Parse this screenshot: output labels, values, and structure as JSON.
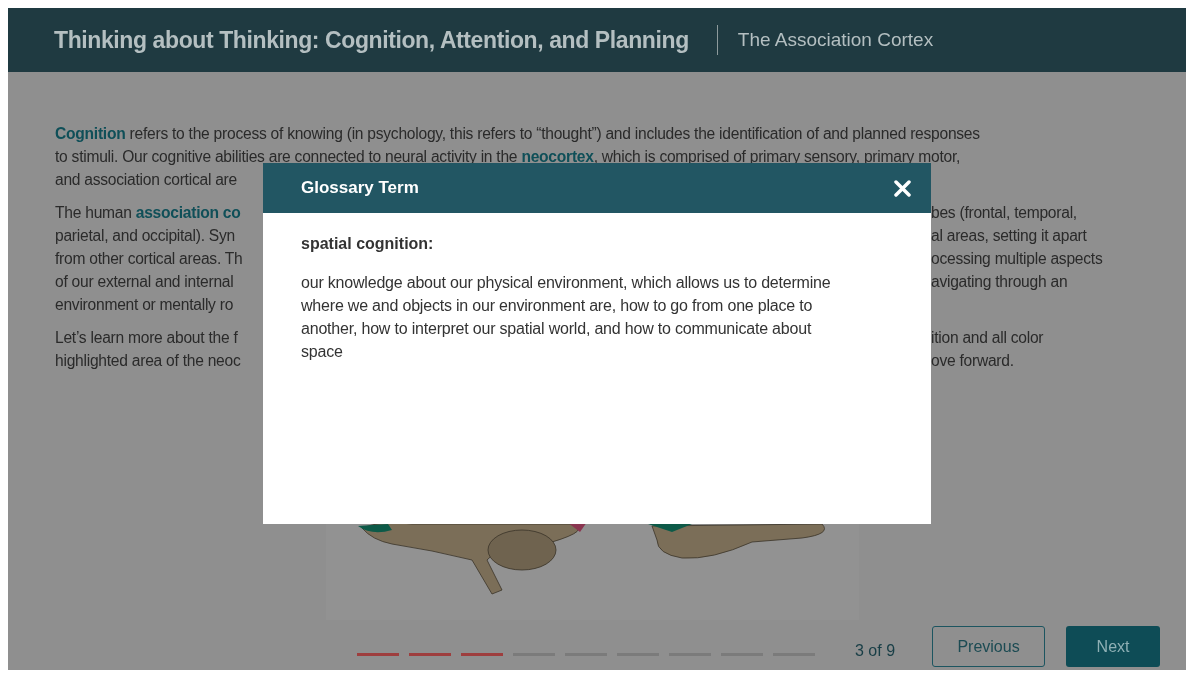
{
  "header": {
    "title": "Thinking about Thinking: Cognition, Attention, and Planning",
    "subtitle": "The Association Cortex"
  },
  "paragraphs": [
    {
      "lines": [
        {
          "left": "**Cognition** refers to the process of knowing (in psychology, this refers to “thought”) and includes the identification of and planned responses"
        },
        {
          "left": "to stimuli. Our cognitive abilities are connected to neural activity in the **neocortex**, which is comprised of primary sensory, primary motor,"
        },
        {
          "left": "and association cortical are"
        }
      ]
    },
    {
      "lines": [
        {
          "left": "The human **association co**",
          "right": "bes (frontal, temporal,"
        },
        {
          "left": "parietal, and occipital). Syn",
          "right": "al areas, setting it apart"
        },
        {
          "left": "from other cortical areas. Th",
          "right": "ocessing multiple aspects"
        },
        {
          "left": "of our external and internal",
          "right": "avigating through an"
        },
        {
          "left": "environment or mentally ro"
        }
      ]
    },
    {
      "lines": [
        {
          "left": "Let’s learn more about the f",
          "right": "ition and all color"
        },
        {
          "left": "highlighted area of the neoc",
          "right": "ove forward."
        }
      ]
    }
  ],
  "progress": {
    "steps": [
      {
        "completed": true
      },
      {
        "completed": true
      },
      {
        "completed": true
      },
      {
        "completed": false
      },
      {
        "completed": false
      },
      {
        "completed": false
      },
      {
        "completed": false
      },
      {
        "completed": false
      },
      {
        "completed": false
      }
    ],
    "label": "3 of 9"
  },
  "buttons": {
    "previous": "Previous",
    "next": "Next"
  },
  "modal": {
    "title": "Glossary Term",
    "term": "spatial cognition:",
    "definition": "our knowledge about our physical environment, which allows us to determine where we and objects in our environment are, how to go from one place to another, how to interpret our spatial world, and how to communicate about space"
  }
}
